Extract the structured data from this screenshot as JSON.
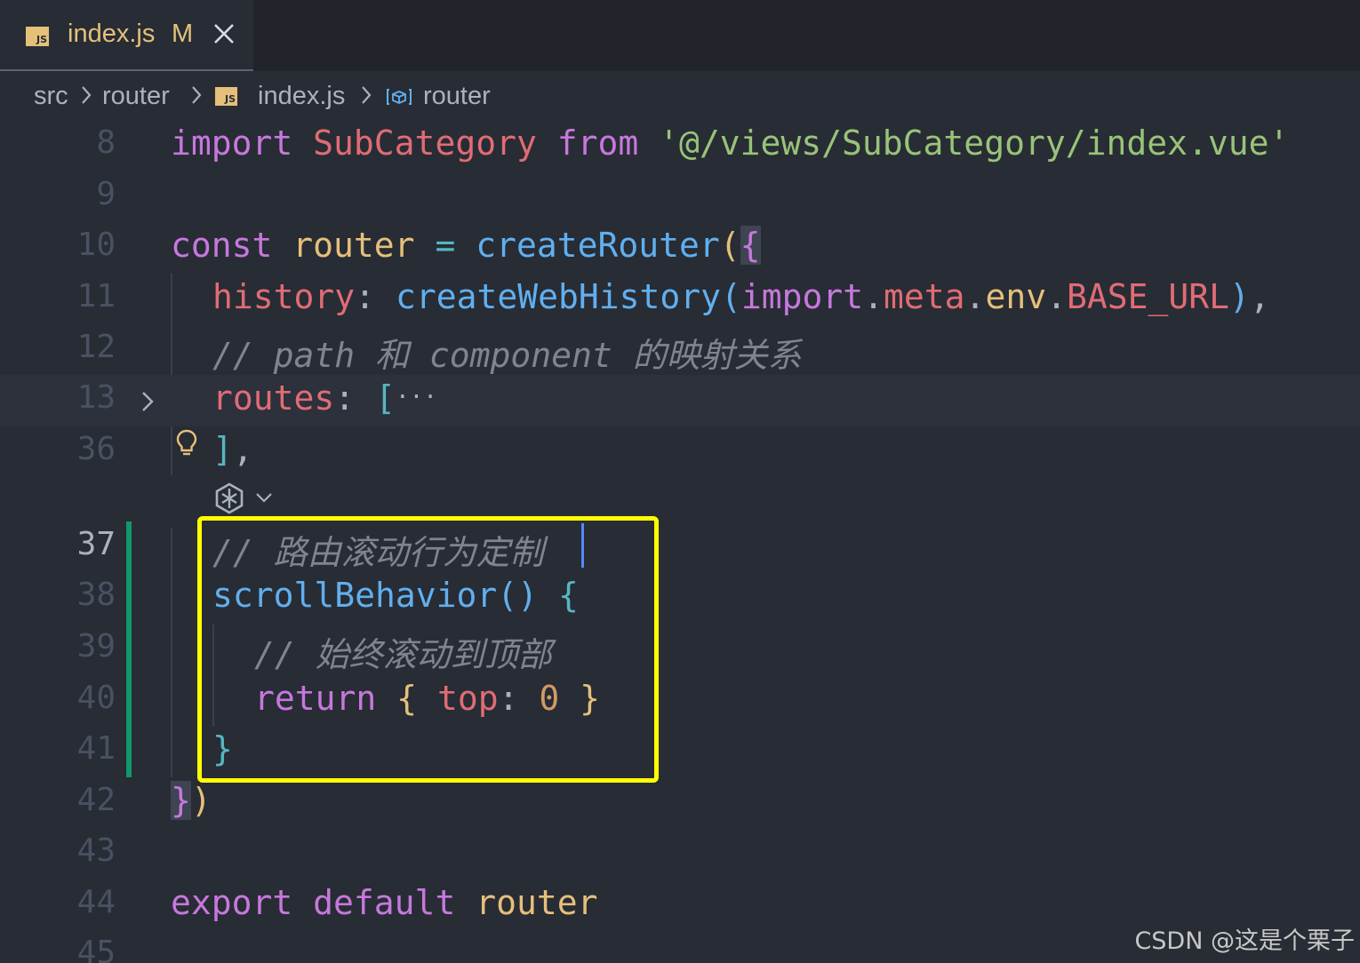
{
  "tab": {
    "icon": "JS",
    "filename": "index.js",
    "modified_marker": "M"
  },
  "breadcrumb": {
    "items": [
      "src",
      "router",
      "index.js",
      "router"
    ],
    "file_icon": "JS"
  },
  "code": {
    "line_numbers": [
      "8",
      "9",
      "10",
      "11",
      "12",
      "13",
      "36",
      "37",
      "38",
      "39",
      "40",
      "41",
      "42",
      "43",
      "44",
      "45"
    ],
    "active_line": "37",
    "tokens": {
      "l8": [
        "import",
        "SubCategory",
        "from",
        "'@/views/SubCategory/index.vue'"
      ],
      "l10": [
        "const",
        "router",
        "=",
        "createRouter",
        "(",
        "{"
      ],
      "l11": [
        "history",
        ":",
        "createWebHistory",
        "(",
        "import",
        ".",
        "meta",
        ".",
        "env",
        ".",
        "BASE_URL",
        ")",
        ","
      ],
      "l12": [
        "// path 和 component 的映射关系"
      ],
      "l13": [
        "routes",
        ":",
        "[",
        "···"
      ],
      "l36": [
        "]",
        ","
      ],
      "l37": [
        "// 路由滚动行为定制"
      ],
      "l38": [
        "scrollBehavior",
        "()",
        "{"
      ],
      "l39": [
        "// 始终滚动到顶部"
      ],
      "l40": [
        "return",
        "{",
        "top",
        ":",
        "0",
        "}"
      ],
      "l41": [
        "}"
      ],
      "l42": [
        "}",
        ")"
      ],
      "l44": [
        "export",
        "default",
        "router"
      ]
    }
  },
  "colors": {
    "background": "#282c34",
    "keyword": "#c678dd",
    "variable": "#e06c75",
    "string": "#98c379",
    "function": "#61afef",
    "comment": "#7f848e",
    "highlight_box": "#ffff00",
    "git_modified_bar": "#109868"
  },
  "icons": [
    "js-file-icon",
    "close-icon",
    "chevron-right-icon",
    "symbol-variable-icon",
    "lightbulb-icon",
    "copilot-icon",
    "chevron-down-icon"
  ],
  "watermark": "CSDN @这是个栗子"
}
